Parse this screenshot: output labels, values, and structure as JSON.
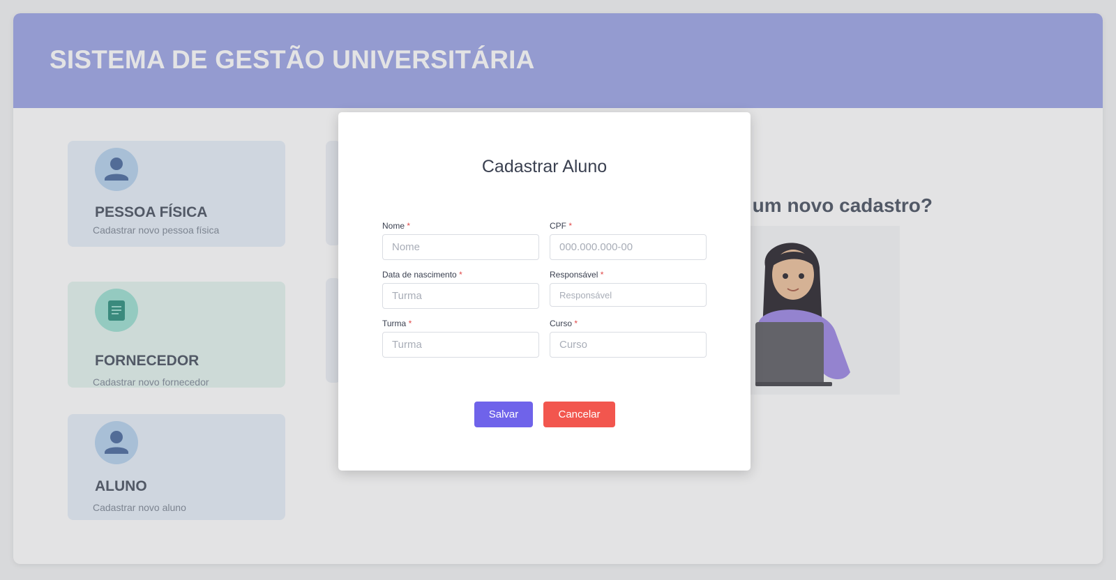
{
  "header": {
    "title": "SISTEMA DE GESTÃO UNIVERSITÁRIA"
  },
  "cards": [
    {
      "title": "PESSOA FÍSICA",
      "subtitle": "Cadastrar novo pessoa física",
      "icon": "person-icon"
    },
    {
      "title": "FORNECEDOR",
      "subtitle": "Cadastrar novo fornecedor",
      "icon": "document-icon"
    },
    {
      "title": "ALUNO",
      "subtitle": "Cadastrar novo aluno",
      "icon": "person-icon"
    }
  ],
  "main": {
    "question": "r um novo cadastro?"
  },
  "modal": {
    "title": "Cadastrar Aluno",
    "fields": {
      "nome": {
        "label": "Nome",
        "placeholder": "Nome",
        "required": "*"
      },
      "cpf": {
        "label": "CPF",
        "placeholder": "000.000.000-00",
        "required": "*"
      },
      "nascimento": {
        "label": "Data de nascimento",
        "placeholder": "Turma",
        "required": "*"
      },
      "responsavel": {
        "label": "Responsável",
        "placeholder": "Responsável",
        "required": "*"
      },
      "turma": {
        "label": "Turma",
        "placeholder": "Turma",
        "required": "*"
      },
      "curso": {
        "label": "Curso",
        "placeholder": "Curso",
        "required": "*"
      }
    },
    "save_label": "Salvar",
    "cancel_label": "Cancelar"
  },
  "colors": {
    "header": "#a6ade9",
    "save": "#6f63ea",
    "cancel": "#f2564e",
    "required": "#e04848"
  }
}
